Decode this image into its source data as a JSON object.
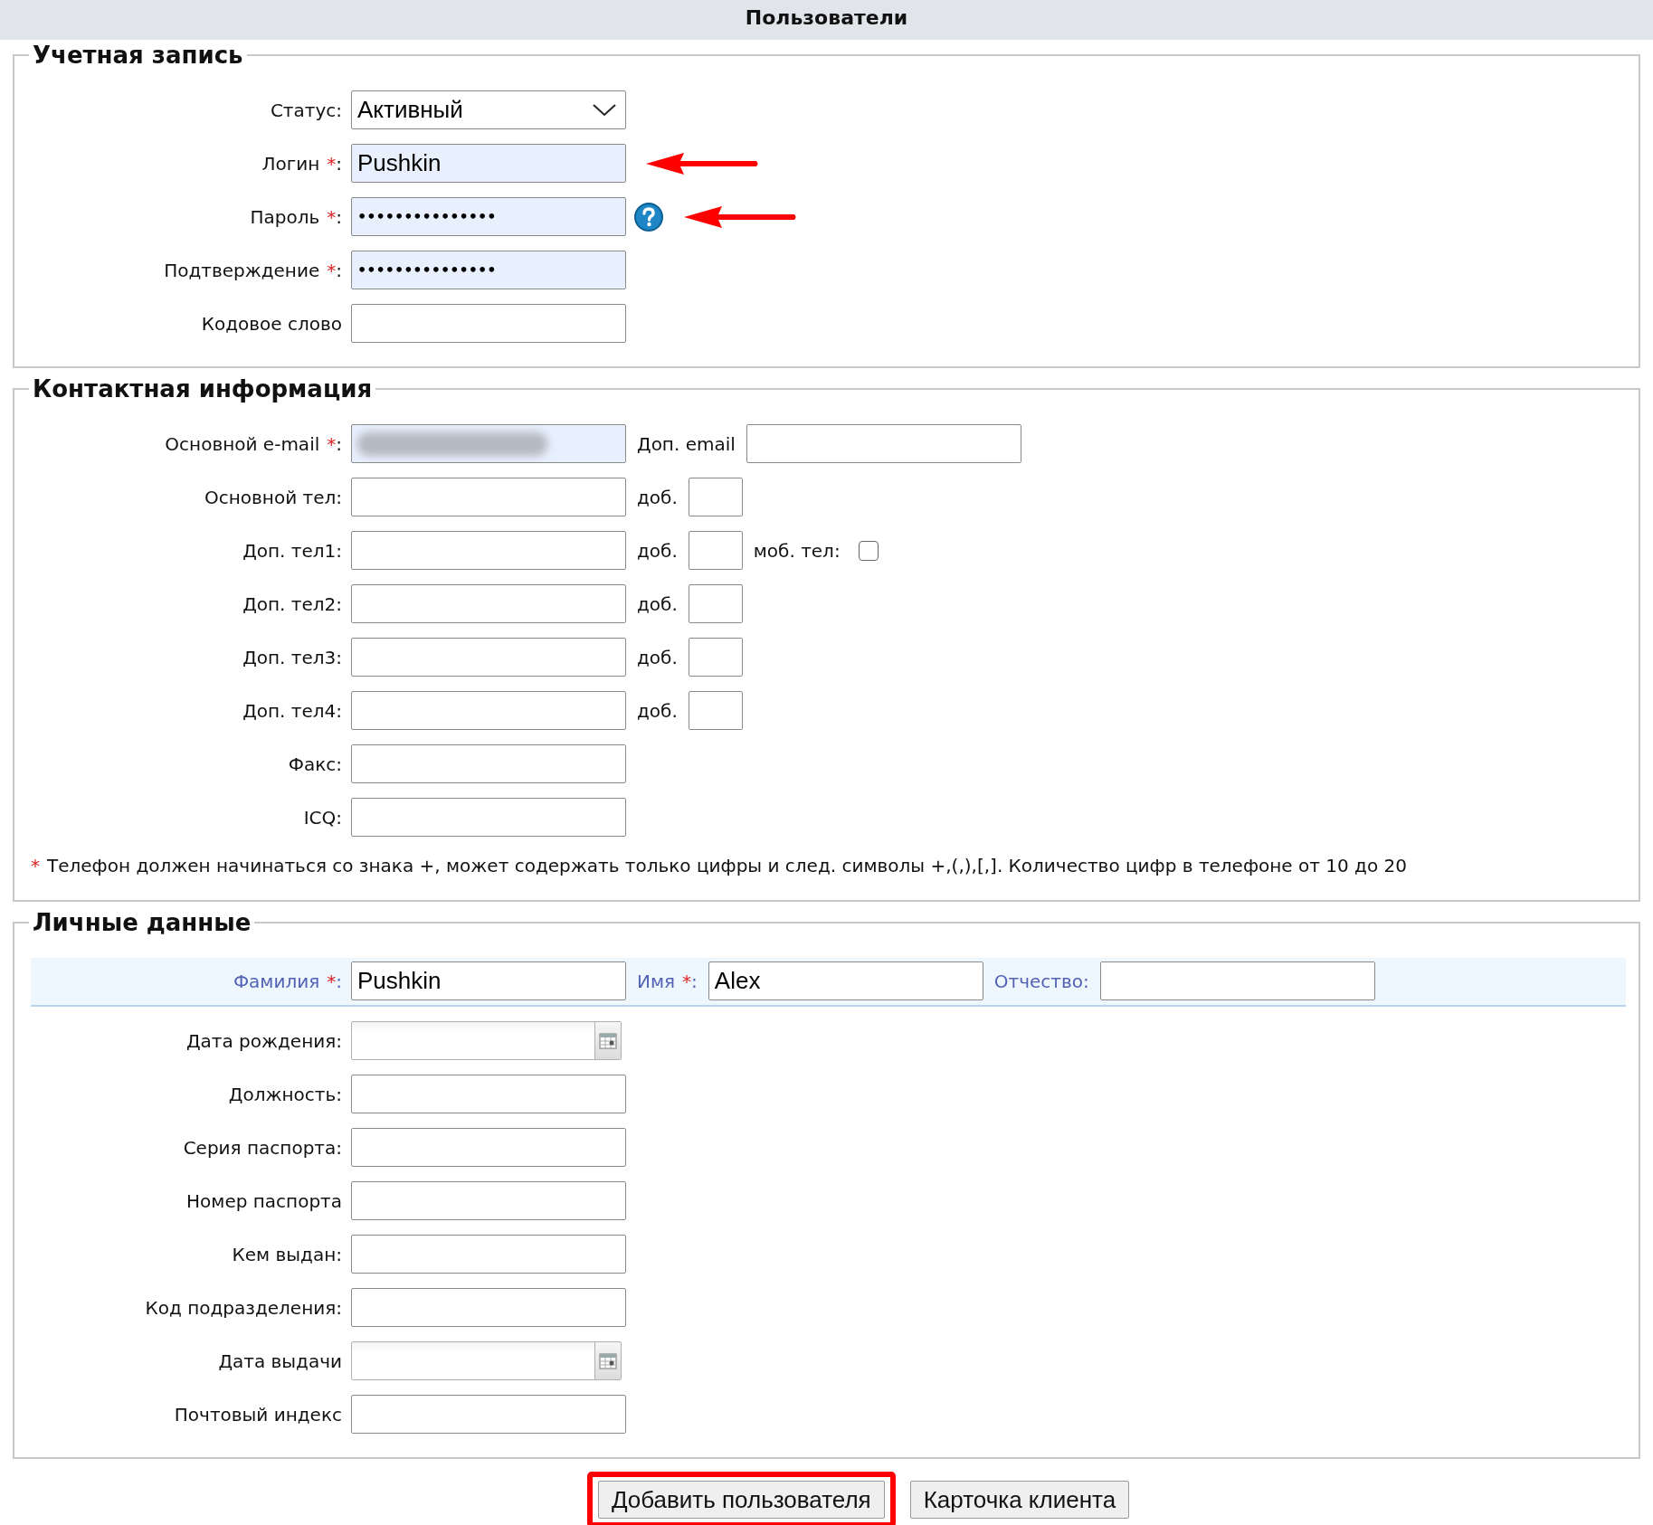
{
  "header": {
    "title": "Пользователи"
  },
  "sections": [
    {
      "title": "Учетная запись",
      "rows": [
        {
          "label": "Статус",
          "colon": ":",
          "controls": [
            {
              "kind": "select",
              "value": "Активный"
            }
          ]
        },
        {
          "label": "Логин",
          "required": "*",
          "colon": ":",
          "controls": [
            {
              "kind": "input",
              "value": "Pushkin",
              "highlighted": true
            },
            {
              "kind": "arrow"
            }
          ]
        },
        {
          "label": "Пароль",
          "required": "*",
          "colon": ":",
          "controls": [
            {
              "kind": "password",
              "value": "•••••••••••••••",
              "highlighted": true
            },
            {
              "kind": "help"
            },
            {
              "kind": "arrow"
            }
          ]
        },
        {
          "label": "Подтверждение",
          "required": "*",
          "colon": ":",
          "controls": [
            {
              "kind": "password",
              "value": "•••••••••••••••",
              "highlighted": true
            }
          ]
        },
        {
          "label": "Кодовое слово",
          "controls": [
            {
              "kind": "input"
            }
          ]
        }
      ]
    },
    {
      "title": "Контактная информация",
      "rows": [
        {
          "label": "Основной e-mail",
          "required": "*",
          "colon": ":",
          "controls": [
            {
              "kind": "input",
              "highlighted": true,
              "redacted": true
            },
            {
              "kind": "text",
              "text": "Доп. email"
            },
            {
              "kind": "input"
            }
          ]
        },
        {
          "label": "Основной тел",
          "colon": ":",
          "controls": [
            {
              "kind": "input"
            },
            {
              "kind": "text",
              "text": "доб."
            },
            {
              "kind": "ext"
            }
          ]
        },
        {
          "label": "Доп. тел1",
          "colon": ":",
          "controls": [
            {
              "kind": "input"
            },
            {
              "kind": "text",
              "text": "доб."
            },
            {
              "kind": "ext"
            },
            {
              "kind": "text",
              "text": "моб. тел:"
            },
            {
              "kind": "checkbox",
              "checked": false
            }
          ]
        },
        {
          "label": "Доп. тел2",
          "colon": ":",
          "controls": [
            {
              "kind": "input"
            },
            {
              "kind": "text",
              "text": "доб."
            },
            {
              "kind": "ext"
            }
          ]
        },
        {
          "label": "Доп. тел3",
          "colon": ":",
          "controls": [
            {
              "kind": "input"
            },
            {
              "kind": "text",
              "text": "доб."
            },
            {
              "kind": "ext"
            }
          ]
        },
        {
          "label": "Доп. тел4",
          "colon": ":",
          "controls": [
            {
              "kind": "input"
            },
            {
              "kind": "text",
              "text": "доб."
            },
            {
              "kind": "ext"
            }
          ]
        },
        {
          "label": "Факс",
          "colon": ":",
          "controls": [
            {
              "kind": "input"
            }
          ]
        },
        {
          "label": "ICQ",
          "colon": ":",
          "controls": [
            {
              "kind": "input"
            }
          ]
        }
      ],
      "note": {
        "mark": "*",
        "text": "Телефон должен начинаться со знака +, может содержать только цифры и след. символы +,(,),[,]. Количество цифр в телефоне от 10 до 20"
      }
    },
    {
      "title": "Личные данные",
      "rows": [
        {
          "label": "Фамилия",
          "required": "*",
          "colon": ":",
          "band": true,
          "controls": [
            {
              "kind": "input",
              "value": "Pushkin"
            },
            {
              "kind": "text",
              "text": "Имя",
              "required": "*",
              "colon": ":"
            },
            {
              "kind": "input",
              "value": "Alex"
            },
            {
              "kind": "text",
              "text": "Отчество:"
            },
            {
              "kind": "input"
            }
          ]
        },
        {
          "label": "Дата рождения",
          "colon": ":",
          "controls": [
            {
              "kind": "date"
            }
          ]
        },
        {
          "label": "Должность",
          "colon": ":",
          "controls": [
            {
              "kind": "input"
            }
          ]
        },
        {
          "label": "Серия паспорта",
          "colon": ":",
          "controls": [
            {
              "kind": "input"
            }
          ]
        },
        {
          "label": "Номер паспорта",
          "controls": [
            {
              "kind": "input"
            }
          ]
        },
        {
          "label": "Кем выдан",
          "colon": ":",
          "controls": [
            {
              "kind": "input"
            }
          ]
        },
        {
          "label": "Код подразделения",
          "colon": ":",
          "controls": [
            {
              "kind": "input"
            }
          ]
        },
        {
          "label": "Дата выдачи",
          "controls": [
            {
              "kind": "date"
            }
          ]
        },
        {
          "label": "Почтовый индекс",
          "controls": [
            {
              "kind": "input"
            }
          ]
        }
      ]
    }
  ],
  "buttons": [
    {
      "label": "Добавить пользователя",
      "highlighted": true
    },
    {
      "label": "Карточка клиента",
      "highlighted": false
    }
  ]
}
